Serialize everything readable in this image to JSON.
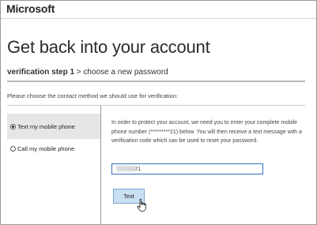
{
  "header": {
    "brand": "Microsoft"
  },
  "page": {
    "title": "Get back into your account",
    "step_label": "verification step 1",
    "step_rest": " > choose a new password",
    "instruction": "Please choose the contact method we should use for verification:"
  },
  "methods": [
    {
      "label": "Text my mobile phone",
      "selected": true
    },
    {
      "label": "Call my mobile phone",
      "selected": false
    }
  ],
  "detail": {
    "description": "In order to protect your account, we need you to enter your complete mobile phone number (*********21) below. You will then receive a text message with a verification code which can be used to reset your password.",
    "phone_value": "        ##21"
  },
  "actions": {
    "text_button": "Text"
  },
  "colors": {
    "selected_bg": "#e6e6e6",
    "input_border": "#2f6fb5",
    "button_bg": "#c9dff2"
  }
}
